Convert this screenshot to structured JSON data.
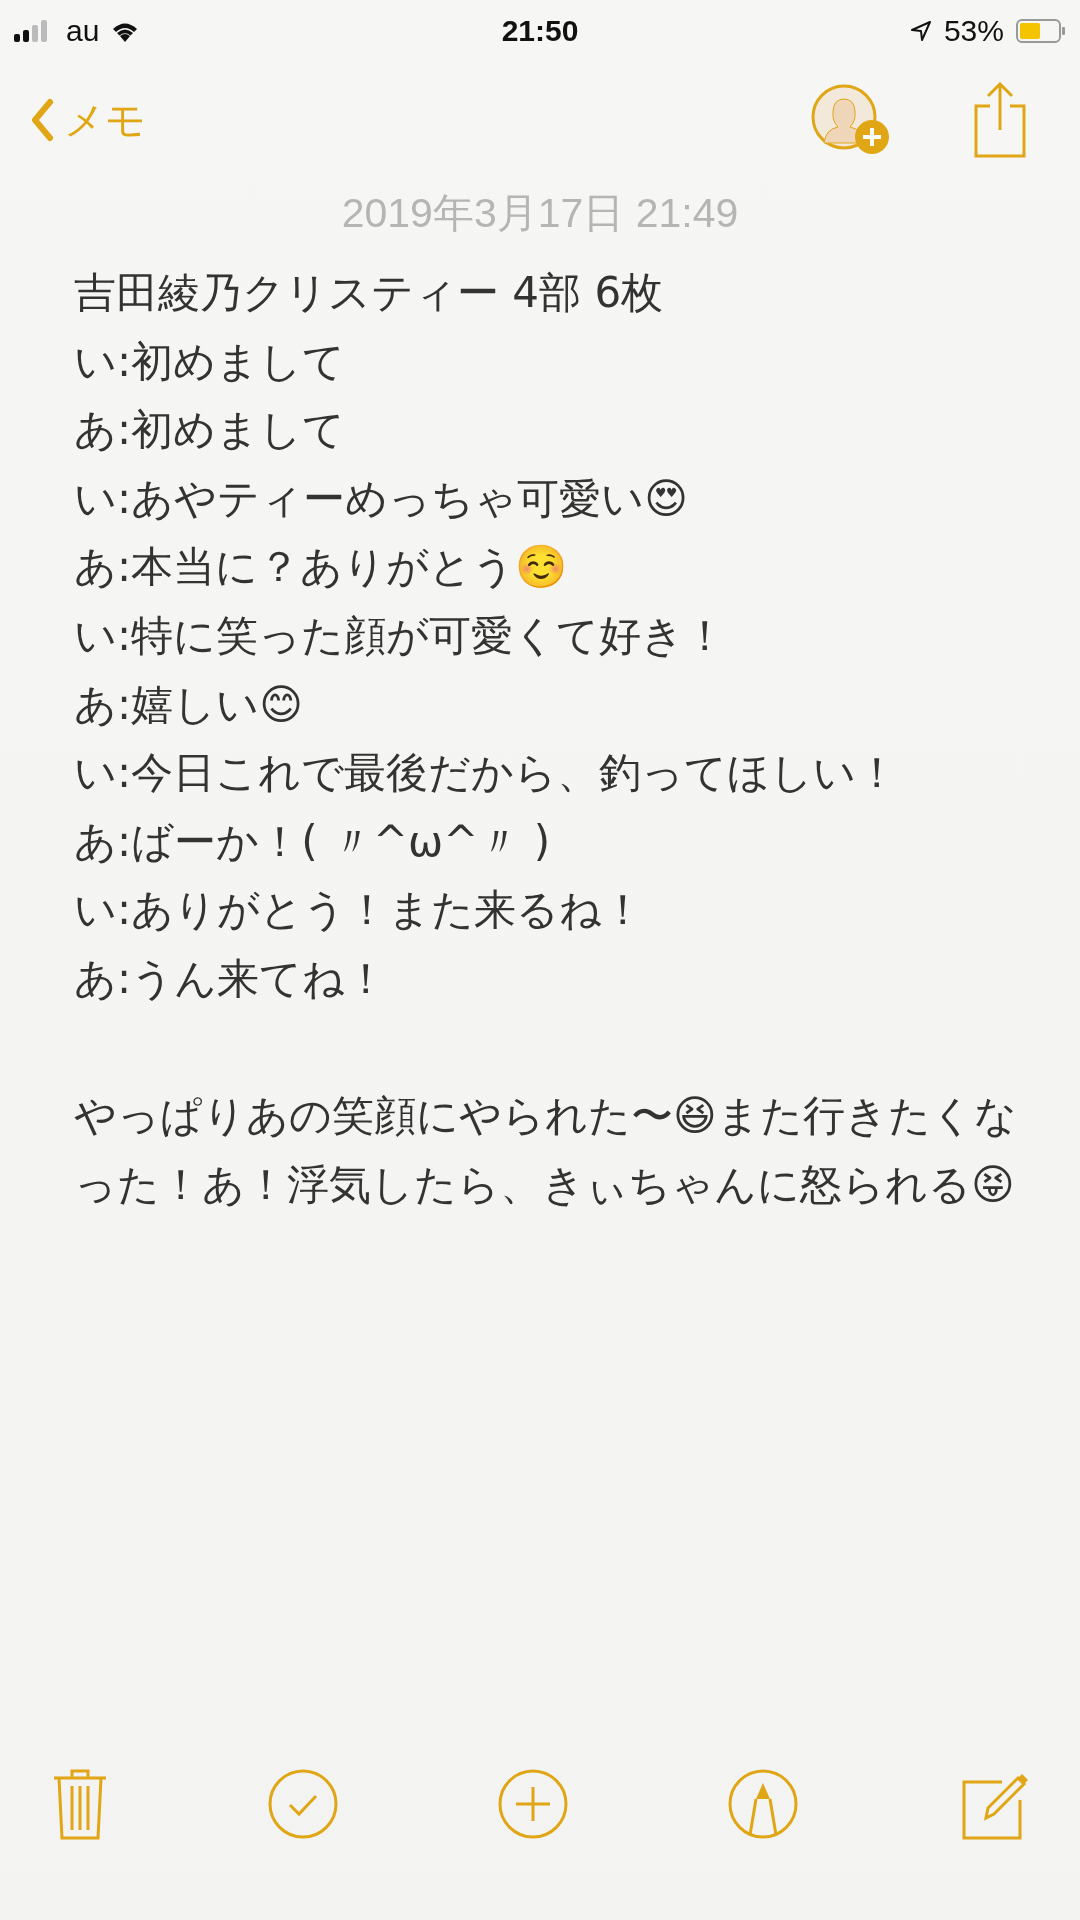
{
  "status_bar": {
    "carrier": "au",
    "time": "21:50",
    "battery": "53%"
  },
  "nav": {
    "back": "メモ"
  },
  "note": {
    "date": "2019年3月17日 21:49",
    "lines": [
      "吉田綾乃クリスティー 4部 6枚",
      "い:初めまして",
      "あ:初めまして",
      "い:あやティーめっちゃ可愛い😍",
      "あ:本当に？ありがとう☺️",
      "い:特に笑った顔が可愛くて好き！",
      "あ:嬉しい😊",
      "い:今日これで最後だから、釣ってほしい！",
      "あ:ばーか！( 〃^ω^〃 )",
      "い:ありがとう！また来るね！",
      "あ:うん来てね！"
    ],
    "closing": "やっぱりあの笑顔にやられた〜😆また行きたくなった！あ！浮気したら、きぃちゃんに怒られる😝"
  },
  "toolbar": [
    {
      "kind": "trash"
    },
    {
      "kind": "check"
    },
    {
      "kind": "add"
    },
    {
      "kind": "markup"
    },
    {
      "kind": "compose"
    }
  ]
}
